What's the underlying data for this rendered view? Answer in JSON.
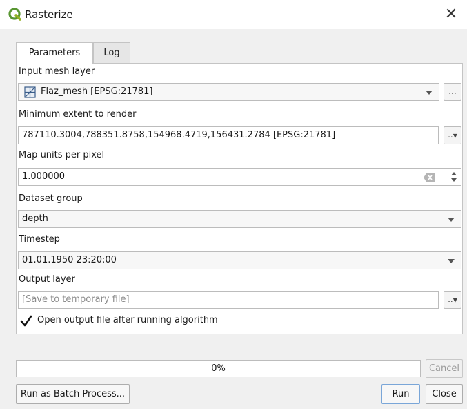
{
  "window": {
    "title": "Rasterize"
  },
  "tabs": [
    {
      "label": "Parameters"
    },
    {
      "label": "Log"
    }
  ],
  "params": {
    "input_mesh_layer": {
      "label": "Input mesh layer",
      "value": "Flaz_mesh [EPSG:21781]",
      "browse": "..."
    },
    "extent": {
      "label": "Minimum extent to render",
      "value": "787110.3004,788351.8758,154968.4719,156431.2784 [EPSG:21781]",
      "menu": ".."
    },
    "map_units": {
      "label": "Map units per pixel",
      "value": "1.000000"
    },
    "dataset_group": {
      "label": "Dataset group",
      "value": "depth"
    },
    "timestep": {
      "label": "Timestep",
      "value": "01.01.1950 23:20:00"
    },
    "output": {
      "label": "Output layer",
      "placeholder": "[Save to temporary file]",
      "menu": ".."
    },
    "open_output": {
      "label": "Open output file after running algorithm",
      "checked": true
    }
  },
  "progress": {
    "value": 0,
    "text": "0%"
  },
  "buttons": {
    "cancel": "Cancel",
    "batch": "Run as Batch Process...",
    "run": "Run",
    "close": "Close"
  },
  "icons": {
    "app": "qgis-logo-icon",
    "close": "close-icon",
    "mesh": "mesh-layer-icon",
    "clear": "clear-icon",
    "spin": "spin-arrows-icon",
    "check": "checkmark-icon"
  },
  "colors": {
    "accent": "#589632",
    "accent_light": "#93b023",
    "panel_bg": "#ffffff",
    "dialog_bg": "#f0f0f0"
  }
}
